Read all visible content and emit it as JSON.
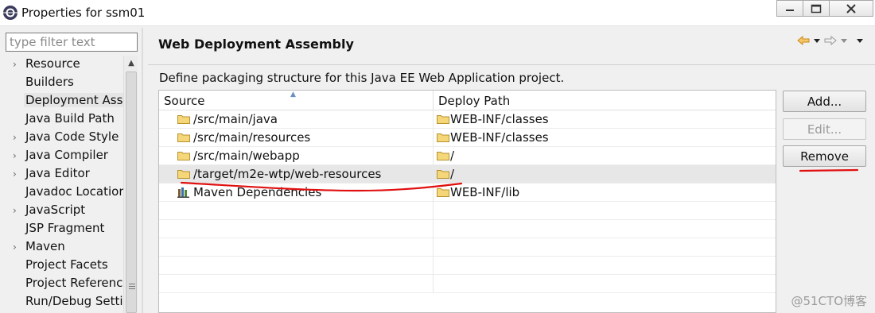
{
  "window": {
    "title": "Properties for ssm01",
    "controls": [
      "minimize",
      "maximize",
      "close"
    ]
  },
  "filter": {
    "placeholder": "type filter text"
  },
  "tree": {
    "items": [
      {
        "label": "Resource",
        "expandable": true
      },
      {
        "label": "Builders",
        "expandable": false
      },
      {
        "label": "Deployment Asse",
        "expandable": false,
        "selected": true
      },
      {
        "label": "Java Build Path",
        "expandable": false
      },
      {
        "label": "Java Code Style",
        "expandable": true
      },
      {
        "label": "Java Compiler",
        "expandable": true
      },
      {
        "label": "Java Editor",
        "expandable": true
      },
      {
        "label": "Javadoc Locatior",
        "expandable": false
      },
      {
        "label": "JavaScript",
        "expandable": true
      },
      {
        "label": "JSP Fragment",
        "expandable": false
      },
      {
        "label": "Maven",
        "expandable": true
      },
      {
        "label": "Project Facets",
        "expandable": false
      },
      {
        "label": "Project Referenc",
        "expandable": false
      },
      {
        "label": "Run/Debug Setti",
        "expandable": false
      }
    ]
  },
  "page": {
    "title": "Web Deployment Assembly",
    "description": "Define packaging structure for this Java EE Web Application project.",
    "nav_icons": [
      "back-arrow-icon",
      "back-menu-icon",
      "forward-arrow-icon",
      "forward-menu-icon",
      "view-menu-icon"
    ]
  },
  "table": {
    "columns": {
      "source": "Source",
      "deploy": "Deploy Path"
    },
    "rows": [
      {
        "source": "/src/main/java",
        "deploy": "WEB-INF/classes",
        "source_icon": "folder-icon"
      },
      {
        "source": "/src/main/resources",
        "deploy": "WEB-INF/classes",
        "source_icon": "folder-icon"
      },
      {
        "source": "/src/main/webapp",
        "deploy": "/",
        "source_icon": "folder-icon"
      },
      {
        "source": "/target/m2e-wtp/web-resources",
        "deploy": "/",
        "source_icon": "folder-icon",
        "highlighted": true
      },
      {
        "source": "Maven Dependencies",
        "deploy": "WEB-INF/lib",
        "source_icon": "library-icon"
      }
    ]
  },
  "buttons": {
    "add": "Add...",
    "edit": "Edit...",
    "remove": "Remove"
  },
  "colors": {
    "annotation_red": "#e01010",
    "folder_yellow": "#e9c45a",
    "nav_arrow_orange": "#e8a13a"
  },
  "watermark": "@51CTO博客"
}
